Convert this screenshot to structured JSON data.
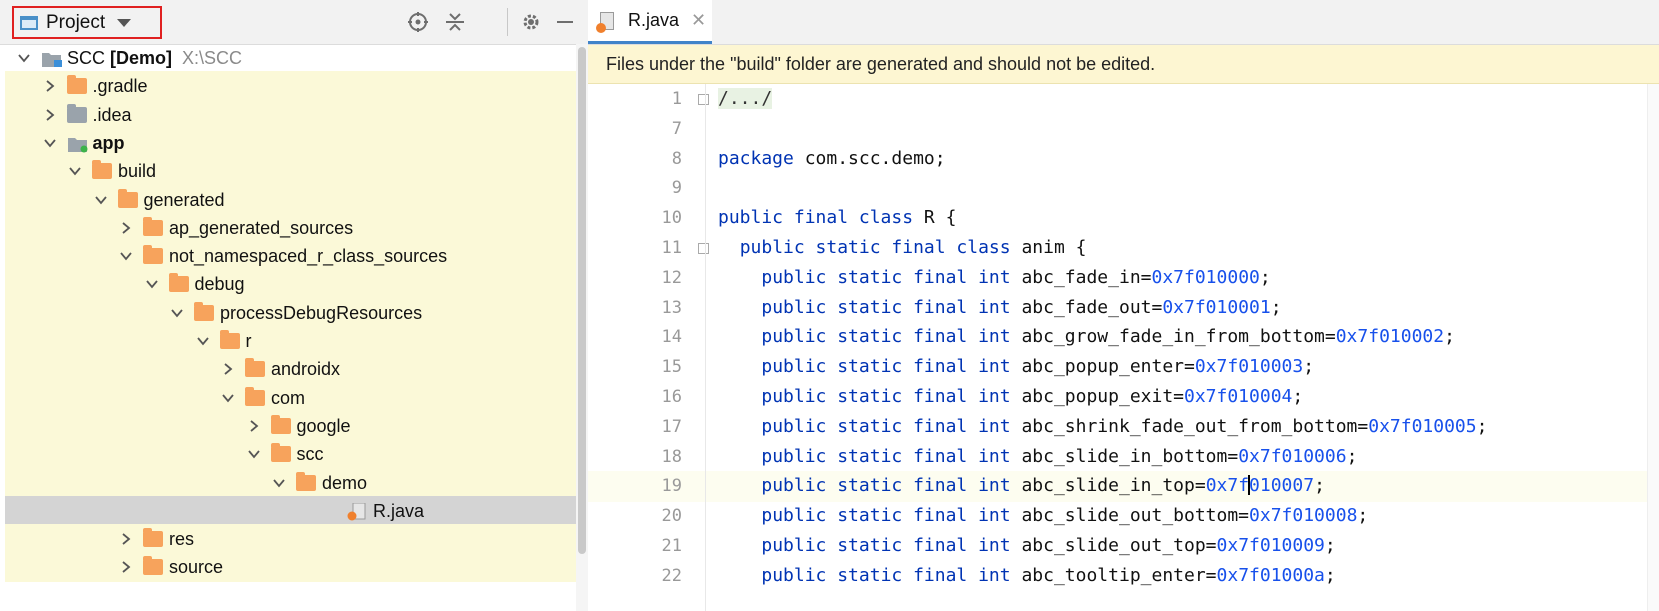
{
  "project_panel": {
    "view_selector_label": "Project",
    "header_icons": [
      "locate-icon",
      "collapse-all-icon",
      "gear-icon",
      "minimize-icon"
    ],
    "tree": [
      {
        "label": "SCC",
        "bold_suffix": "[Demo]",
        "path": "X:\\SCC",
        "expanded": true,
        "icon": "module-icon"
      },
      {
        "label": ".gradle",
        "expanded": false,
        "icon": "folder-orange"
      },
      {
        "label": ".idea",
        "expanded": false,
        "icon": "folder-grey"
      },
      {
        "label": "app",
        "expanded": true,
        "icon": "module-folder"
      },
      {
        "label": "build",
        "expanded": true,
        "icon": "folder-orange"
      },
      {
        "label": "generated",
        "expanded": true,
        "icon": "folder-orange"
      },
      {
        "label": "ap_generated_sources",
        "expanded": false,
        "icon": "folder-orange"
      },
      {
        "label": "not_namespaced_r_class_sources",
        "expanded": true,
        "icon": "folder-orange"
      },
      {
        "label": "debug",
        "expanded": true,
        "icon": "folder-orange"
      },
      {
        "label": "processDebugResources",
        "expanded": true,
        "icon": "folder-orange"
      },
      {
        "label": "r",
        "expanded": true,
        "icon": "folder-orange"
      },
      {
        "label": "androidx",
        "expanded": false,
        "icon": "folder-orange"
      },
      {
        "label": "com",
        "expanded": true,
        "icon": "folder-orange"
      },
      {
        "label": "google",
        "expanded": false,
        "icon": "folder-orange"
      },
      {
        "label": "scc",
        "expanded": true,
        "icon": "folder-orange"
      },
      {
        "label": "demo",
        "expanded": true,
        "icon": "folder-orange"
      },
      {
        "label": "R.java",
        "icon": "java-file-icon",
        "selected": true
      },
      {
        "label": "res",
        "expanded": false,
        "icon": "folder-orange"
      },
      {
        "label": "source",
        "expanded": false,
        "icon": "folder-orange"
      }
    ]
  },
  "editor": {
    "tab": {
      "label": "R.java",
      "close": "✕"
    },
    "banner": "Files under the \"build\" folder are generated and should not be edited.",
    "lines": [
      {
        "n": "1",
        "segs": [
          {
            "t": "/.../",
            "c": "folded"
          }
        ]
      },
      {
        "n": "7",
        "segs": []
      },
      {
        "n": "8",
        "segs": [
          {
            "t": "package",
            "c": "kw"
          },
          {
            "t": " com.scc.demo;"
          }
        ]
      },
      {
        "n": "9",
        "segs": []
      },
      {
        "n": "10",
        "segs": [
          {
            "t": "public final class",
            "c": "kw"
          },
          {
            "t": " R {"
          }
        ]
      },
      {
        "n": "11",
        "segs": [
          {
            "t": "  "
          },
          {
            "t": "public static final class",
            "c": "kw"
          },
          {
            "t": " anim {"
          }
        ]
      },
      {
        "n": "12",
        "segs": [
          {
            "t": "    "
          },
          {
            "t": "public static final int",
            "c": "kw"
          },
          {
            "t": " abc_fade_in="
          },
          {
            "t": "0x7f010000",
            "c": "num"
          },
          {
            "t": ";"
          }
        ]
      },
      {
        "n": "13",
        "segs": [
          {
            "t": "    "
          },
          {
            "t": "public static final int",
            "c": "kw"
          },
          {
            "t": " abc_fade_out="
          },
          {
            "t": "0x7f010001",
            "c": "num"
          },
          {
            "t": ";"
          }
        ]
      },
      {
        "n": "14",
        "segs": [
          {
            "t": "    "
          },
          {
            "t": "public static final int",
            "c": "kw"
          },
          {
            "t": " abc_grow_fade_in_from_bottom="
          },
          {
            "t": "0x7f010002",
            "c": "num"
          },
          {
            "t": ";"
          }
        ]
      },
      {
        "n": "15",
        "segs": [
          {
            "t": "    "
          },
          {
            "t": "public static final int",
            "c": "kw"
          },
          {
            "t": " abc_popup_enter="
          },
          {
            "t": "0x7f010003",
            "c": "num"
          },
          {
            "t": ";"
          }
        ]
      },
      {
        "n": "16",
        "segs": [
          {
            "t": "    "
          },
          {
            "t": "public static final int",
            "c": "kw"
          },
          {
            "t": " abc_popup_exit="
          },
          {
            "t": "0x7f010004",
            "c": "num"
          },
          {
            "t": ";"
          }
        ]
      },
      {
        "n": "17",
        "segs": [
          {
            "t": "    "
          },
          {
            "t": "public static final int",
            "c": "kw"
          },
          {
            "t": " abc_shrink_fade_out_from_bottom="
          },
          {
            "t": "0x7f010005",
            "c": "num"
          },
          {
            "t": ";"
          }
        ]
      },
      {
        "n": "18",
        "segs": [
          {
            "t": "    "
          },
          {
            "t": "public static final int",
            "c": "kw"
          },
          {
            "t": " abc_slide_in_bottom="
          },
          {
            "t": "0x7f010006",
            "c": "num"
          },
          {
            "t": ";"
          }
        ]
      },
      {
        "n": "19",
        "segs": [
          {
            "t": "    "
          },
          {
            "t": "public static final int",
            "c": "kw"
          },
          {
            "t": " abc_slide_in_top="
          },
          {
            "t": "0x7f",
            "c": "num"
          },
          {
            "t": "|",
            "c": "caret"
          },
          {
            "t": "010007",
            "c": "num"
          },
          {
            "t": ";"
          }
        ],
        "current": true
      },
      {
        "n": "20",
        "segs": [
          {
            "t": "    "
          },
          {
            "t": "public static final int",
            "c": "kw"
          },
          {
            "t": " abc_slide_out_bottom="
          },
          {
            "t": "0x7f010008",
            "c": "num"
          },
          {
            "t": ";"
          }
        ]
      },
      {
        "n": "21",
        "segs": [
          {
            "t": "    "
          },
          {
            "t": "public static final int",
            "c": "kw"
          },
          {
            "t": " abc_slide_out_top="
          },
          {
            "t": "0x7f010009",
            "c": "num"
          },
          {
            "t": ";"
          }
        ]
      },
      {
        "n": "22",
        "segs": [
          {
            "t": "    "
          },
          {
            "t": "public static final int",
            "c": "kw"
          },
          {
            "t": " abc_tooltip_enter="
          },
          {
            "t": "0x7f01000a",
            "c": "num"
          },
          {
            "t": ";"
          }
        ]
      }
    ]
  },
  "colors": {
    "keyword": "#0033b3",
    "number": "#1750eb",
    "folder": "#f7a35c",
    "selection": "#d4d4d4",
    "highlight": "#fbf9d8",
    "banner": "#fdf6d2",
    "annotation_box": "#e02020"
  }
}
